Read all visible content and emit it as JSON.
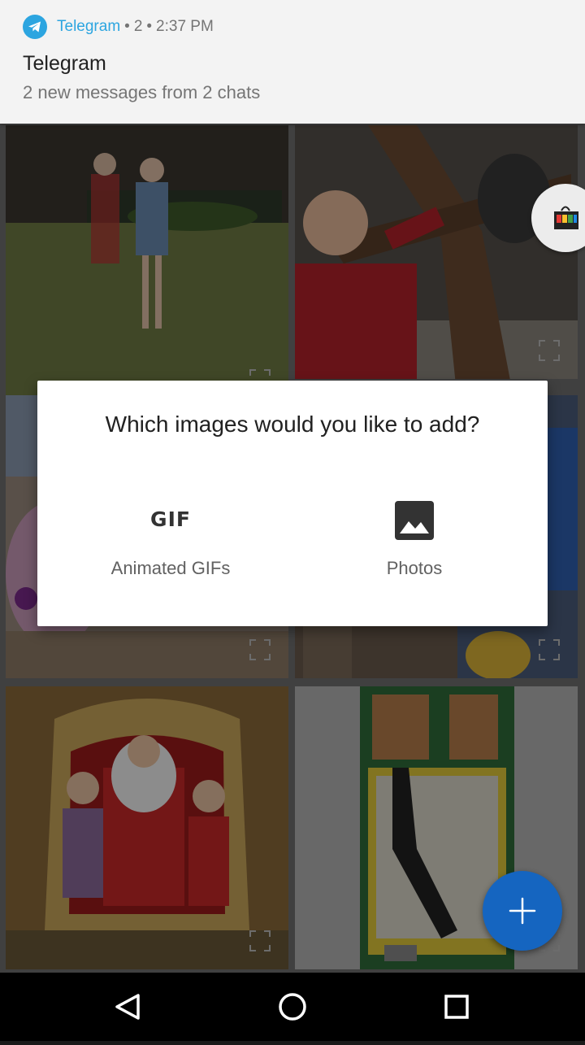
{
  "notification": {
    "app_name": "Telegram",
    "count": "2",
    "time": "2:37 PM",
    "title": "Telegram",
    "text": "2 new messages from 2 chats",
    "icon": "telegram-icon",
    "accent": "#2ca5e0"
  },
  "dialog": {
    "question": "Which images would you like to add?",
    "gif_glyph": "GIF",
    "gif_label": "Animated GIFs",
    "photos_label": "Photos",
    "gif_icon": "gif-icon",
    "photos_icon": "image-icon"
  },
  "gallery": {
    "tiles": [
      "photo-kids-garden",
      "photo-boy-koala",
      "photo-kids-left-partial",
      "photo-boy-tshirt-partial",
      "photo-santa",
      "photo-phone-internals"
    ]
  },
  "fab": {
    "icon": "plus-icon",
    "color": "#1565c0"
  },
  "navbar": {
    "back_icon": "back-triangle-icon",
    "home_icon": "home-circle-icon",
    "recents_icon": "recents-square-icon"
  }
}
